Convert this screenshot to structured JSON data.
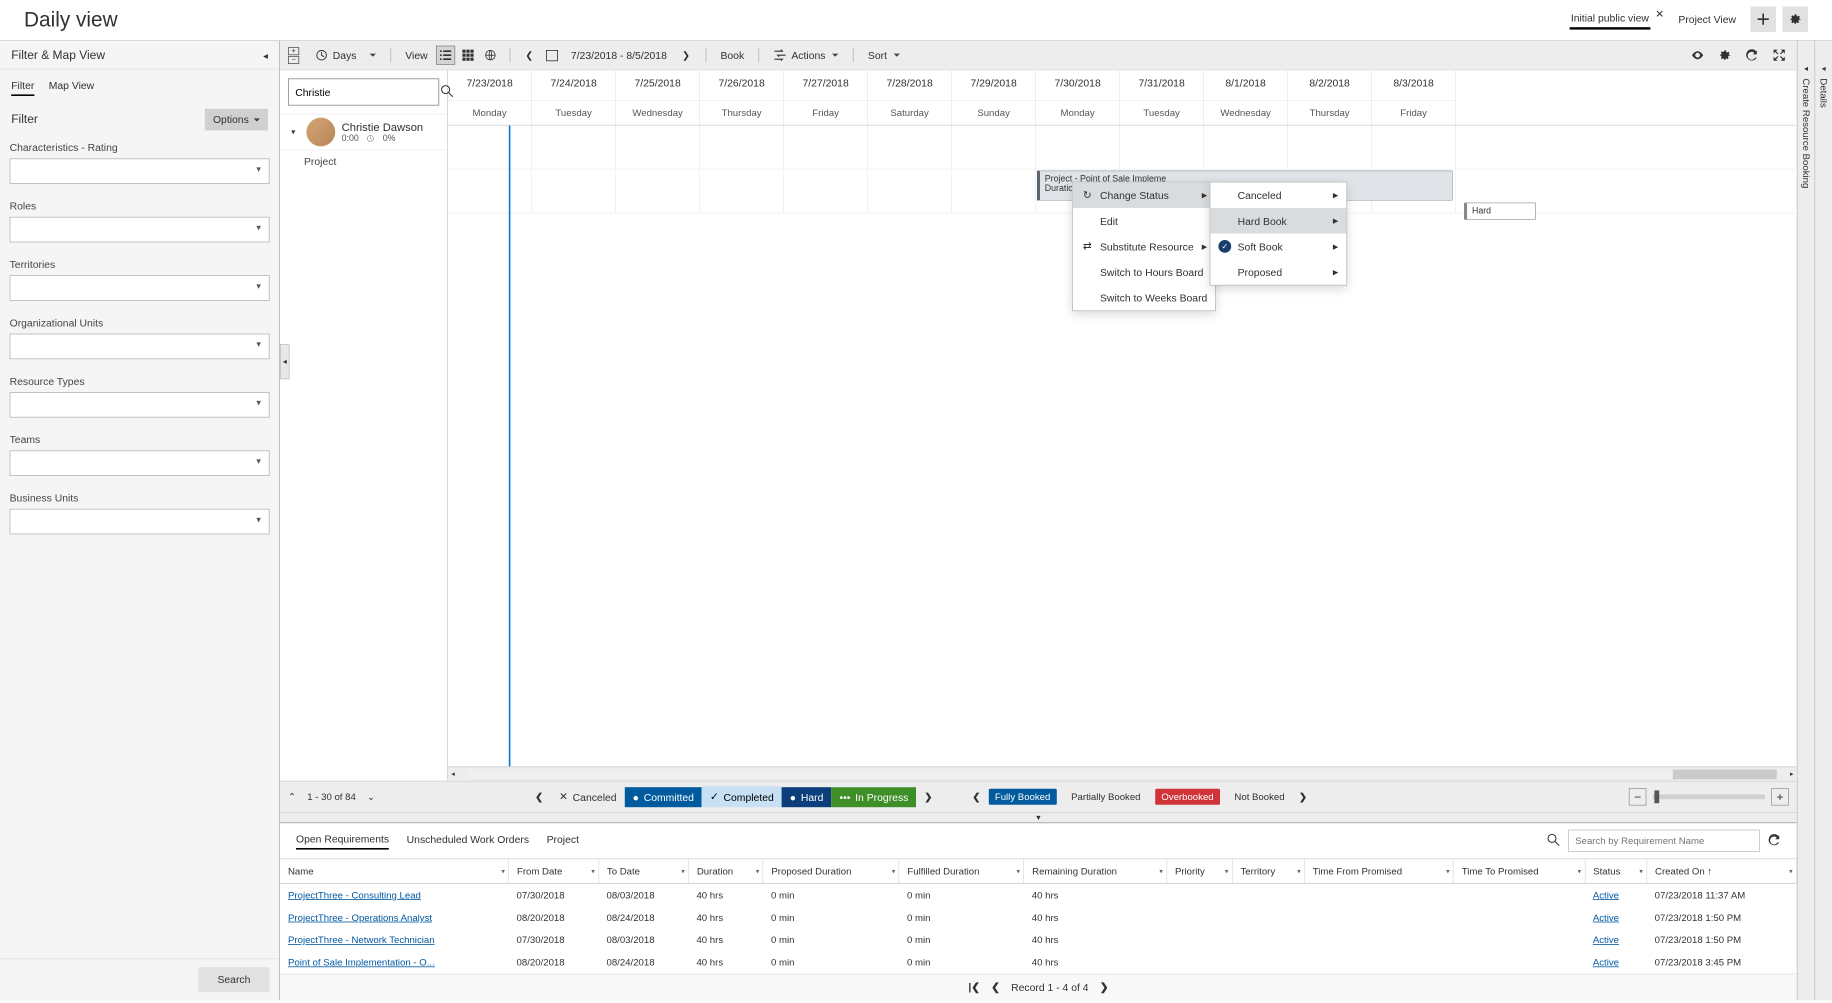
{
  "header": {
    "title": "Daily view",
    "views": [
      {
        "label": "Initial public view",
        "active": true,
        "closable": true
      },
      {
        "label": "Project View",
        "active": false,
        "closable": false
      }
    ]
  },
  "sidebar": {
    "panel_title": "Filter & Map View",
    "tabs": [
      {
        "label": "Filter",
        "active": true
      },
      {
        "label": "Map View",
        "active": false
      }
    ],
    "filter_label": "Filter",
    "options_label": "Options",
    "fields": [
      {
        "label": "Characteristics - Rating"
      },
      {
        "label": "Roles"
      },
      {
        "label": "Territories"
      },
      {
        "label": "Organizational Units"
      },
      {
        "label": "Resource Types"
      },
      {
        "label": "Teams"
      },
      {
        "label": "Business Units"
      }
    ],
    "search_btn": "Search"
  },
  "toolbar": {
    "days_label": "Days",
    "view_label": "View",
    "date_range": "7/23/2018 - 8/5/2018",
    "book_label": "Book",
    "actions_label": "Actions",
    "sort_label": "Sort"
  },
  "resources": {
    "search_value": "Christie",
    "items": [
      {
        "name": "Christie Dawson",
        "duration": "0:00",
        "percent": "0%",
        "children": [
          {
            "label": "Project"
          }
        ]
      }
    ]
  },
  "calendar": {
    "days": [
      {
        "date": "7/23/2018",
        "name": "Monday"
      },
      {
        "date": "7/24/2018",
        "name": "Tuesday"
      },
      {
        "date": "7/25/2018",
        "name": "Wednesday"
      },
      {
        "date": "7/26/2018",
        "name": "Thursday"
      },
      {
        "date": "7/27/2018",
        "name": "Friday"
      },
      {
        "date": "7/28/2018",
        "name": "Saturday"
      },
      {
        "date": "7/29/2018",
        "name": "Sunday"
      },
      {
        "date": "7/30/2018",
        "name": "Monday"
      },
      {
        "date": "7/31/2018",
        "name": "Tuesday"
      },
      {
        "date": "8/1/2018",
        "name": "Wednesday"
      },
      {
        "date": "8/2/2018",
        "name": "Thursday"
      },
      {
        "date": "8/3/2018",
        "name": "Friday"
      }
    ],
    "booking": {
      "title": "Project - Point of Sale Impleme",
      "subtitle": "Duration:",
      "hard_label": "Hard"
    }
  },
  "context_menu": {
    "items": [
      {
        "label": "Change Status",
        "icon": "cycle",
        "sub": true,
        "hover": true
      },
      {
        "label": "Edit"
      },
      {
        "label": "Substitute Resource",
        "icon": "swap",
        "sub": true
      },
      {
        "label": "Switch to Hours Board"
      },
      {
        "label": "Switch to Weeks Board"
      }
    ],
    "submenu": [
      {
        "label": "Canceled",
        "sub": true
      },
      {
        "label": "Hard Book",
        "sub": true,
        "hover": true
      },
      {
        "label": "Soft Book",
        "sub": true,
        "icon": "check"
      },
      {
        "label": "Proposed",
        "sub": true
      }
    ]
  },
  "legend": {
    "pager_text": "1 - 30 of 84",
    "chips": [
      {
        "label": "Canceled",
        "cls": "cancel",
        "icon": "x"
      },
      {
        "label": "Committed",
        "cls": "commit",
        "icon": "dot"
      },
      {
        "label": "Completed",
        "cls": "complete",
        "icon": "check"
      },
      {
        "label": "Hard",
        "cls": "hard",
        "icon": "dot"
      },
      {
        "label": "In Progress",
        "cls": "progress",
        "icon": "dots"
      }
    ],
    "status": [
      {
        "label": "Fully Booked",
        "cls": "blue"
      },
      {
        "label": "Partially Booked",
        "cls": ""
      },
      {
        "label": "Overbooked",
        "cls": "red"
      },
      {
        "label": "Not Booked",
        "cls": ""
      }
    ]
  },
  "bottom": {
    "tabs": [
      {
        "label": "Open Requirements",
        "active": true
      },
      {
        "label": "Unscheduled Work Orders",
        "active": false
      },
      {
        "label": "Project",
        "active": false
      }
    ],
    "search_placeholder": "Search by Requirement Name",
    "columns": [
      "Name",
      "From Date",
      "To Date",
      "Duration",
      "Proposed Duration",
      "Fulfilled Duration",
      "Remaining Duration",
      "Priority",
      "Territory",
      "Time From Promised",
      "Time To Promised",
      "Status",
      "Created On"
    ],
    "rows": [
      {
        "name": "ProjectThree - Consulting Lead",
        "from": "07/30/2018",
        "to": "08/03/2018",
        "dur": "40 hrs",
        "prop": "0 min",
        "ful": "0 min",
        "rem": "40 hrs",
        "pri": "",
        "terr": "",
        "tfp": "",
        "ttp": "",
        "status": "Active",
        "created": "07/23/2018 11:37 AM"
      },
      {
        "name": "ProjectThree - Operations Analyst",
        "from": "08/20/2018",
        "to": "08/24/2018",
        "dur": "40 hrs",
        "prop": "0 min",
        "ful": "0 min",
        "rem": "40 hrs",
        "pri": "",
        "terr": "",
        "tfp": "",
        "ttp": "",
        "status": "Active",
        "created": "07/23/2018 1:50 PM"
      },
      {
        "name": "ProjectThree - Network Technician",
        "from": "07/30/2018",
        "to": "08/03/2018",
        "dur": "40 hrs",
        "prop": "0 min",
        "ful": "0 min",
        "rem": "40 hrs",
        "pri": "",
        "terr": "",
        "tfp": "",
        "ttp": "",
        "status": "Active",
        "created": "07/23/2018 1:50 PM"
      },
      {
        "name": "Point of Sale Implementation - O...",
        "from": "08/20/2018",
        "to": "08/24/2018",
        "dur": "40 hrs",
        "prop": "0 min",
        "ful": "0 min",
        "rem": "40 hrs",
        "pri": "",
        "terr": "",
        "tfp": "",
        "ttp": "",
        "status": "Active",
        "created": "07/23/2018 3:45 PM"
      }
    ],
    "record_text": "Record 1 - 4 of 4"
  },
  "rails": {
    "details": "Details",
    "create": "Create Resource Booking"
  }
}
